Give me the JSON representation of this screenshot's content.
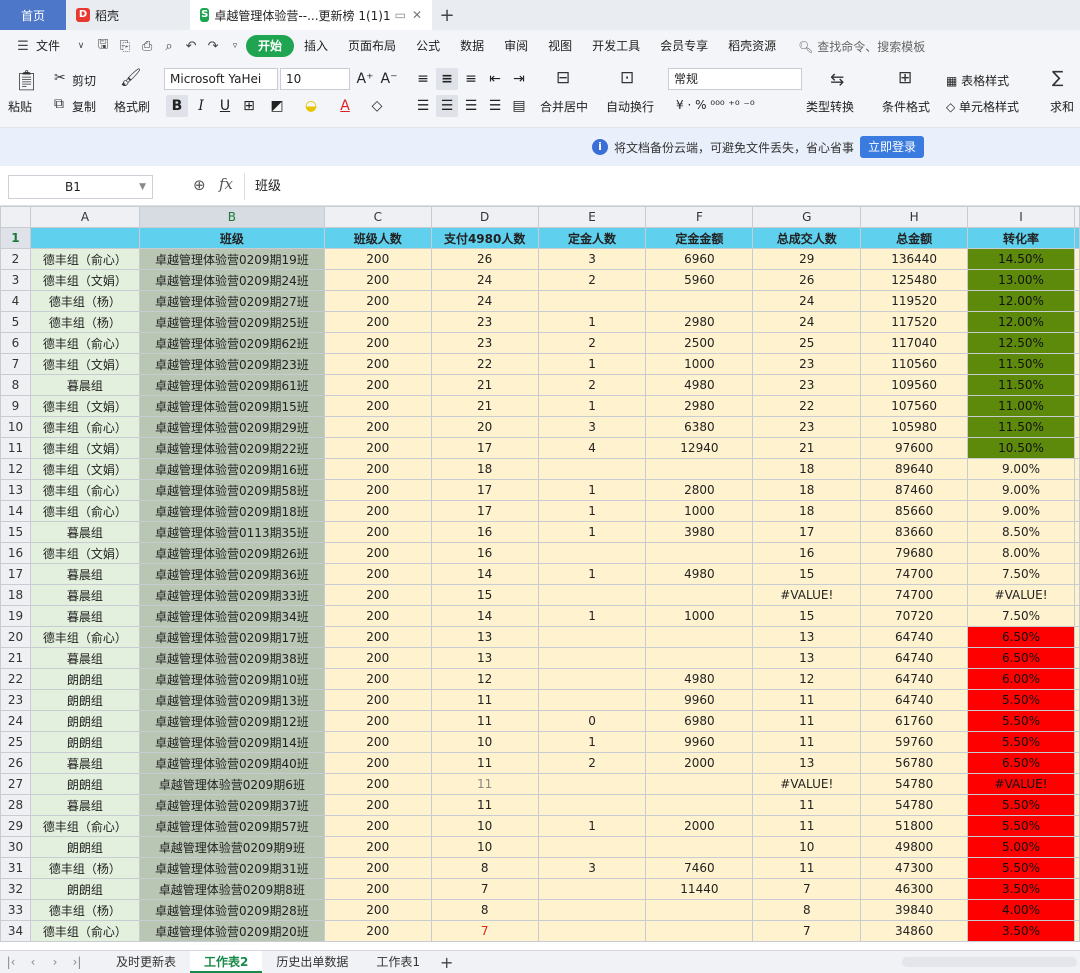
{
  "tabs": {
    "home": "首页",
    "daoke": "稻壳",
    "active_doc": "卓越管理体验营--...更新榜 1(1)1",
    "badge_daoke": "D",
    "badge_doc": "S"
  },
  "menu": {
    "file": "文件",
    "items": [
      "开始",
      "插入",
      "页面布局",
      "公式",
      "数据",
      "审阅",
      "视图",
      "开发工具",
      "会员专享",
      "稻壳资源"
    ],
    "search": "查找命令、搜索模板"
  },
  "ribbon": {
    "paste": "粘贴",
    "cut": "剪切",
    "copy": "复制",
    "format_painter": "格式刷",
    "font_name": "Microsoft YaHei",
    "font_size": "10",
    "merge_center": "合并居中",
    "wrap": "自动换行",
    "number_format": "常规",
    "type_convert": "类型转换",
    "cond_format": "条件格式",
    "table_style": "表格样式",
    "cell_style": "单元格样式",
    "sum": "求和"
  },
  "notice": {
    "message": "将文档备份云端，可避免文件丢失，省心省事",
    "login": "立即登录"
  },
  "formula_bar": {
    "cell_ref": "B1",
    "fx": "fx",
    "content": "班级"
  },
  "columns": [
    "A",
    "B",
    "C",
    "D",
    "E",
    "F",
    "G",
    "H",
    "I"
  ],
  "header_row": [
    "",
    "班级",
    "班级人数",
    "支付4980人数",
    "定金人数",
    "定金金额",
    "总成交人数",
    "总金额",
    "转化率"
  ],
  "rows": [
    [
      "德丰组（俞心）",
      "卓越管理体验营0209期19班",
      "200",
      "26",
      "3",
      "6960",
      "29",
      "136440",
      "14.50%",
      "green"
    ],
    [
      "德丰组（文娟）",
      "卓越管理体验营0209期24班",
      "200",
      "24",
      "2",
      "5960",
      "26",
      "125480",
      "13.00%",
      "green"
    ],
    [
      "德丰组（杨）",
      "卓越管理体验营0209期27班",
      "200",
      "24",
      "",
      "",
      "24",
      "119520",
      "12.00%",
      "green"
    ],
    [
      "德丰组（杨）",
      "卓越管理体验营0209期25班",
      "200",
      "23",
      "1",
      "2980",
      "24",
      "117520",
      "12.00%",
      "green"
    ],
    [
      "德丰组（俞心）",
      "卓越管理体验营0209期62班",
      "200",
      "23",
      "2",
      "2500",
      "25",
      "117040",
      "12.50%",
      "green"
    ],
    [
      "德丰组（文娟）",
      "卓越管理体验营0209期23班",
      "200",
      "22",
      "1",
      "1000",
      "23",
      "110560",
      "11.50%",
      "green"
    ],
    [
      "暮晨组",
      "卓越管理体验营0209期61班",
      "200",
      "21",
      "2",
      "4980",
      "23",
      "109560",
      "11.50%",
      "green"
    ],
    [
      "德丰组（文娟）",
      "卓越管理体验营0209期15班",
      "200",
      "21",
      "1",
      "2980",
      "22",
      "107560",
      "11.00%",
      "green"
    ],
    [
      "德丰组（俞心）",
      "卓越管理体验营0209期29班",
      "200",
      "20",
      "3",
      "6380",
      "23",
      "105980",
      "11.50%",
      "green"
    ],
    [
      "德丰组（文娟）",
      "卓越管理体验营0209期22班",
      "200",
      "17",
      "4",
      "12940",
      "21",
      "97600",
      "10.50%",
      "green"
    ],
    [
      "德丰组（文娟）",
      "卓越管理体验营0209期16班",
      "200",
      "18",
      "",
      "",
      "18",
      "89640",
      "9.00%",
      "norm"
    ],
    [
      "德丰组（俞心）",
      "卓越管理体验营0209期58班",
      "200",
      "17",
      "1",
      "2800",
      "18",
      "87460",
      "9.00%",
      "norm"
    ],
    [
      "德丰组（俞心）",
      "卓越管理体验营0209期18班",
      "200",
      "17",
      "1",
      "1000",
      "18",
      "85660",
      "9.00%",
      "norm"
    ],
    [
      "暮晨组",
      "卓越管理体验营0113期35班",
      "200",
      "16",
      "1",
      "3980",
      "17",
      "83660",
      "8.50%",
      "norm"
    ],
    [
      "德丰组（文娟）",
      "卓越管理体验营0209期26班",
      "200",
      "16",
      "",
      "",
      "16",
      "79680",
      "8.00%",
      "norm"
    ],
    [
      "暮晨组",
      "卓越管理体验营0209期36班",
      "200",
      "14",
      "1",
      "4980",
      "15",
      "74700",
      "7.50%",
      "norm"
    ],
    [
      "暮晨组",
      "卓越管理体验营0209期33班",
      "200",
      "15",
      "",
      "",
      "#VALUE!",
      "74700",
      "#VALUE!",
      "norm"
    ],
    [
      "暮晨组",
      "卓越管理体验营0209期34班",
      "200",
      "14",
      "1",
      "1000",
      "15",
      "70720",
      "7.50%",
      "norm"
    ],
    [
      "德丰组（俞心）",
      "卓越管理体验营0209期17班",
      "200",
      "13",
      "",
      "",
      "13",
      "64740",
      "6.50%",
      "red"
    ],
    [
      "暮晨组",
      "卓越管理体验营0209期38班",
      "200",
      "13",
      "",
      "",
      "13",
      "64740",
      "6.50%",
      "red"
    ],
    [
      "朗朗组",
      "卓越管理体验营0209期10班",
      "200",
      "12",
      "",
      "4980",
      "12",
      "64740",
      "6.00%",
      "red"
    ],
    [
      "朗朗组",
      "卓越管理体验营0209期13班",
      "200",
      "11",
      "",
      "9960",
      "11",
      "64740",
      "5.50%",
      "red"
    ],
    [
      "朗朗组",
      "卓越管理体验营0209期12班",
      "200",
      "11",
      "0",
      "6980",
      "11",
      "61760",
      "5.50%",
      "red"
    ],
    [
      "朗朗组",
      "卓越管理体验营0209期14班",
      "200",
      "10",
      "1",
      "9960",
      "11",
      "59760",
      "5.50%",
      "red"
    ],
    [
      "暮晨组",
      "卓越管理体验营0209期40班",
      "200",
      "11",
      "2",
      "2000",
      "13",
      "56780",
      "6.50%",
      "red"
    ],
    [
      "朗朗组",
      "卓越管理体验营0209期6班",
      "200",
      "11",
      "",
      "",
      "#VALUE!",
      "54780",
      "#VALUE!",
      "red"
    ],
    [
      "暮晨组",
      "卓越管理体验营0209期37班",
      "200",
      "11",
      "",
      "",
      "11",
      "54780",
      "5.50%",
      "red"
    ],
    [
      "德丰组（俞心）",
      "卓越管理体验营0209期57班",
      "200",
      "10",
      "1",
      "2000",
      "11",
      "51800",
      "5.50%",
      "red"
    ],
    [
      "朗朗组",
      "卓越管理体验营0209期9班",
      "200",
      "10",
      "",
      "",
      "10",
      "49800",
      "5.00%",
      "red"
    ],
    [
      "德丰组（杨）",
      "卓越管理体验营0209期31班",
      "200",
      "8",
      "3",
      "7460",
      "11",
      "47300",
      "5.50%",
      "red"
    ],
    [
      "朗朗组",
      "卓越管理体验营0209期8班",
      "200",
      "7",
      "",
      "11440",
      "7",
      "46300",
      "3.50%",
      "red"
    ],
    [
      "德丰组（杨）",
      "卓越管理体验营0209期28班",
      "200",
      "8",
      "",
      "",
      "8",
      "39840",
      "4.00%",
      "red"
    ],
    [
      "德丰组（俞心）",
      "卓越管理体验营0209期20班",
      "200",
      "7",
      "",
      "",
      "7",
      "34860",
      "3.50%",
      "red"
    ]
  ],
  "sheet_tabs": [
    "及时更新表",
    "工作表2",
    "历史出单数据",
    "工作表1"
  ],
  "active_sheet": "工作表2",
  "colors": {
    "header_cyan": "#5fd0ee",
    "rate_green": "#5e8a0c",
    "rate_red": "#ff0000",
    "cell_cream": "#fff3cf",
    "start_green": "#1fa552"
  }
}
